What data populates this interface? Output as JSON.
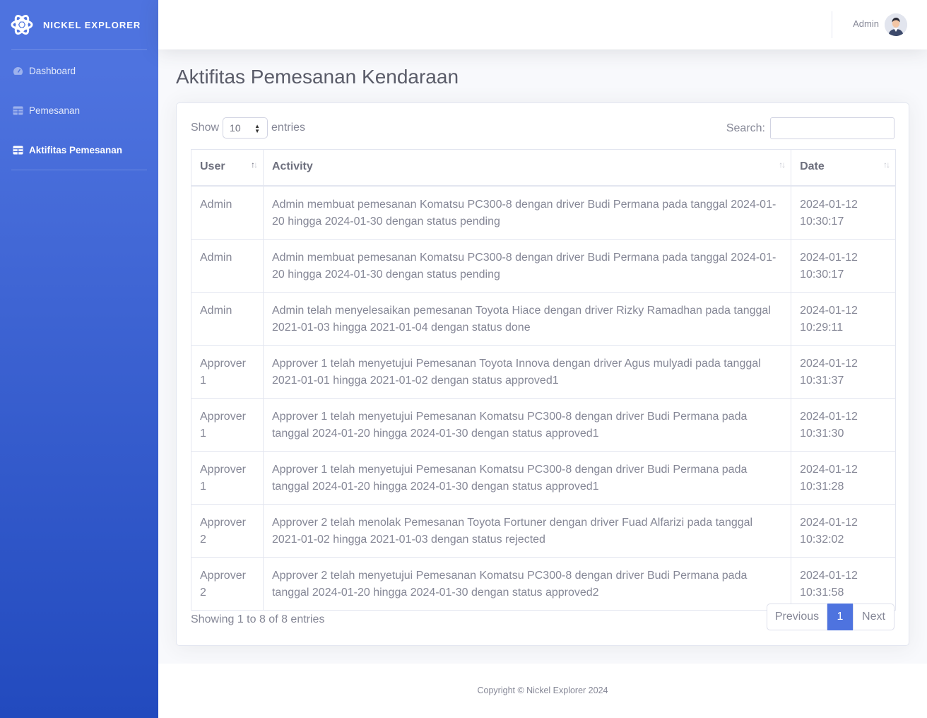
{
  "brand": {
    "name": "NICKEL EXPLORER",
    "icon": "atom-icon"
  },
  "sidebar": {
    "items": [
      {
        "label": "Dashboard",
        "icon": "tachometer-icon",
        "active": false
      },
      {
        "label": "Pemesanan",
        "icon": "table-icon",
        "active": false
      },
      {
        "label": "Aktifitas Pemesanan",
        "icon": "table-icon",
        "active": true
      }
    ]
  },
  "topbar": {
    "user_name": "Admin"
  },
  "page": {
    "title": "Aktifitas Pemesanan Kendaraan"
  },
  "table_controls": {
    "show_label": "Show",
    "entries_label": "entries",
    "page_size": "10",
    "search_label": "Search:",
    "search_value": ""
  },
  "table": {
    "columns": [
      "User",
      "Activity",
      "Date"
    ],
    "rows": [
      {
        "user": "Admin",
        "activity": "Admin membuat pemesanan Komatsu PC300-8 dengan driver Budi Permana pada tanggal 2024-01-20 hingga 2024-01-30 dengan status pending",
        "date": "2024-01-12 10:30:17"
      },
      {
        "user": "Admin",
        "activity": "Admin membuat pemesanan Komatsu PC300-8 dengan driver Budi Permana pada tanggal 2024-01-20 hingga 2024-01-30 dengan status pending",
        "date": "2024-01-12 10:30:17"
      },
      {
        "user": "Admin",
        "activity": "Admin telah menyelesaikan pemesanan Toyota Hiace dengan driver Rizky Ramadhan pada tanggal 2021-01-03 hingga 2021-01-04 dengan status done",
        "date": "2024-01-12 10:29:11"
      },
      {
        "user": "Approver 1",
        "activity": "Approver 1 telah menyetujui Pemesanan Toyota Innova dengan driver Agus mulyadi pada tanggal 2021-01-01 hingga 2021-01-02 dengan status approved1",
        "date": "2024-01-12 10:31:37"
      },
      {
        "user": "Approver 1",
        "activity": "Approver 1 telah menyetujui Pemesanan Komatsu PC300-8 dengan driver Budi Permana pada tanggal 2024-01-20 hingga 2024-01-30 dengan status approved1",
        "date": "2024-01-12 10:31:30"
      },
      {
        "user": "Approver 1",
        "activity": "Approver 1 telah menyetujui Pemesanan Komatsu PC300-8 dengan driver Budi Permana pada tanggal 2024-01-20 hingga 2024-01-30 dengan status approved1",
        "date": "2024-01-12 10:31:28"
      },
      {
        "user": "Approver 2",
        "activity": "Approver 2 telah menolak Pemesanan Toyota Fortuner dengan driver Fuad Alfarizi pada tanggal 2021-01-02 hingga 2021-01-03 dengan status rejected",
        "date": "2024-01-12 10:32:02"
      },
      {
        "user": "Approver 2",
        "activity": "Approver 2 telah menyetujui Pemesanan Komatsu PC300-8 dengan driver Budi Permana pada tanggal 2024-01-20 hingga 2024-01-30 dengan status approved2",
        "date": "2024-01-12 10:31:58"
      }
    ]
  },
  "table_info": "Showing 1 to 8 of 8 entries",
  "pagination": {
    "previous": "Previous",
    "current": "1",
    "next": "Next"
  },
  "footer": {
    "copyright": "Copyright © Nickel Explorer 2024"
  },
  "colors": {
    "primary": "#4e73df",
    "primary_dark": "#224abe",
    "text": "#858796",
    "heading": "#5a5c69"
  }
}
